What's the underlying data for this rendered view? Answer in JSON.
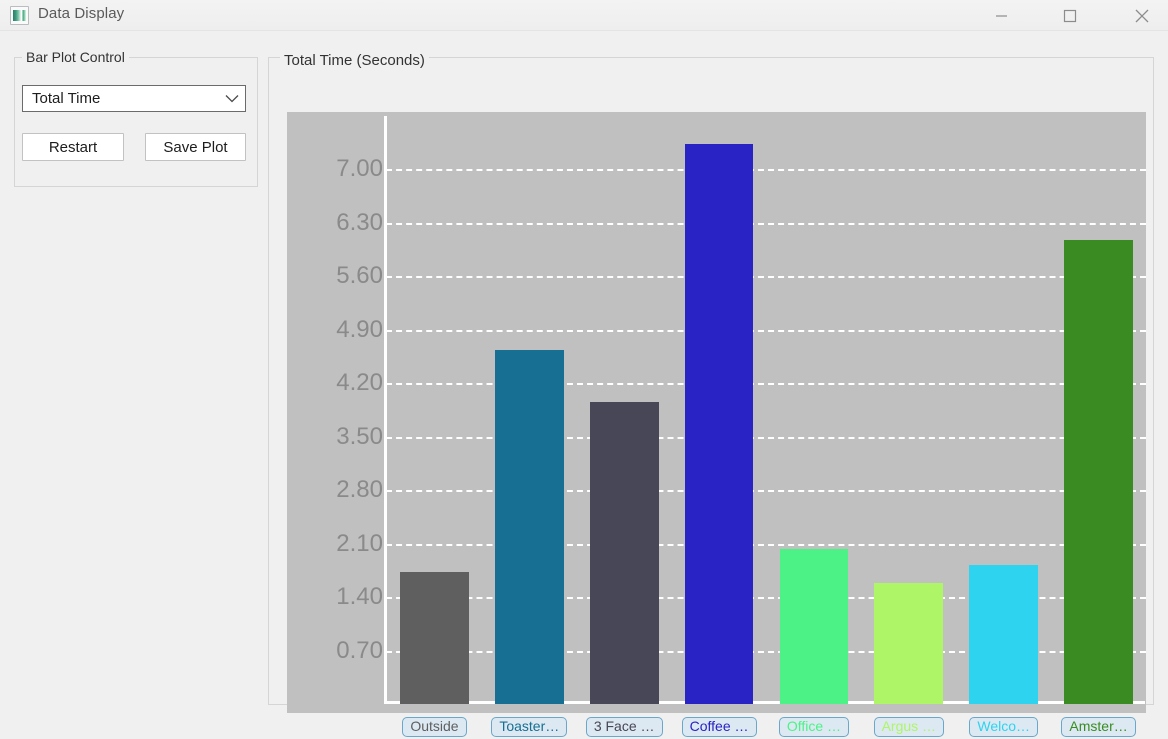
{
  "window": {
    "title": "Data Display",
    "icon": "image-plot-icon",
    "controls": {
      "minimize": "minimize-icon",
      "maximize": "maximize-icon",
      "close": "close-icon"
    }
  },
  "control_panel": {
    "group_title": "Bar Plot Control",
    "dropdown": {
      "name": "plot-mode-select",
      "value": "Total Time",
      "arrow_icon": "chevron-down-icon",
      "options": [
        "Total Time"
      ]
    },
    "buttons": {
      "restart": "Restart",
      "save_plot": "Save Plot"
    }
  },
  "plot_panel": {
    "group_title": "Total Time (Seconds)"
  },
  "chart_data": {
    "type": "bar",
    "title": "Total Time (Seconds)",
    "xlabel": "",
    "ylabel": "Total Time (Seconds)",
    "ylim": [
      0,
      7.7
    ],
    "grid": true,
    "legend": "none",
    "yticks": [
      "0.70",
      "1.40",
      "2.10",
      "2.80",
      "3.50",
      "4.20",
      "4.90",
      "5.60",
      "6.30",
      "7.00"
    ],
    "ytick_values": [
      0.7,
      1.4,
      2.1,
      2.8,
      3.5,
      4.2,
      4.9,
      5.6,
      6.3,
      7.0
    ],
    "categories": [
      "Outside",
      "Toaster…",
      "3 Face …",
      "Coffee …",
      "Office …",
      "Argus …",
      "Welco…",
      "Amster…"
    ],
    "values": [
      1.73,
      4.63,
      3.96,
      7.34,
      2.03,
      1.58,
      1.82,
      6.08
    ],
    "colors": [
      "#5f5f5f",
      "#176f93",
      "#474757",
      "#2922c4",
      "#4df287",
      "#aef567",
      "#2ed3f0",
      "#3a8c22"
    ],
    "label_colors": [
      "#5f5f5f",
      "#176f93",
      "#474757",
      "#2922c4",
      "#4df287",
      "#aef567",
      "#2ed3f0",
      "#3a8c22"
    ],
    "plot_background": "#c0c0c0",
    "gridline_color": "#ffffff",
    "axis_color": "#ffffff",
    "tick_label_color": "#8a8a8a"
  }
}
